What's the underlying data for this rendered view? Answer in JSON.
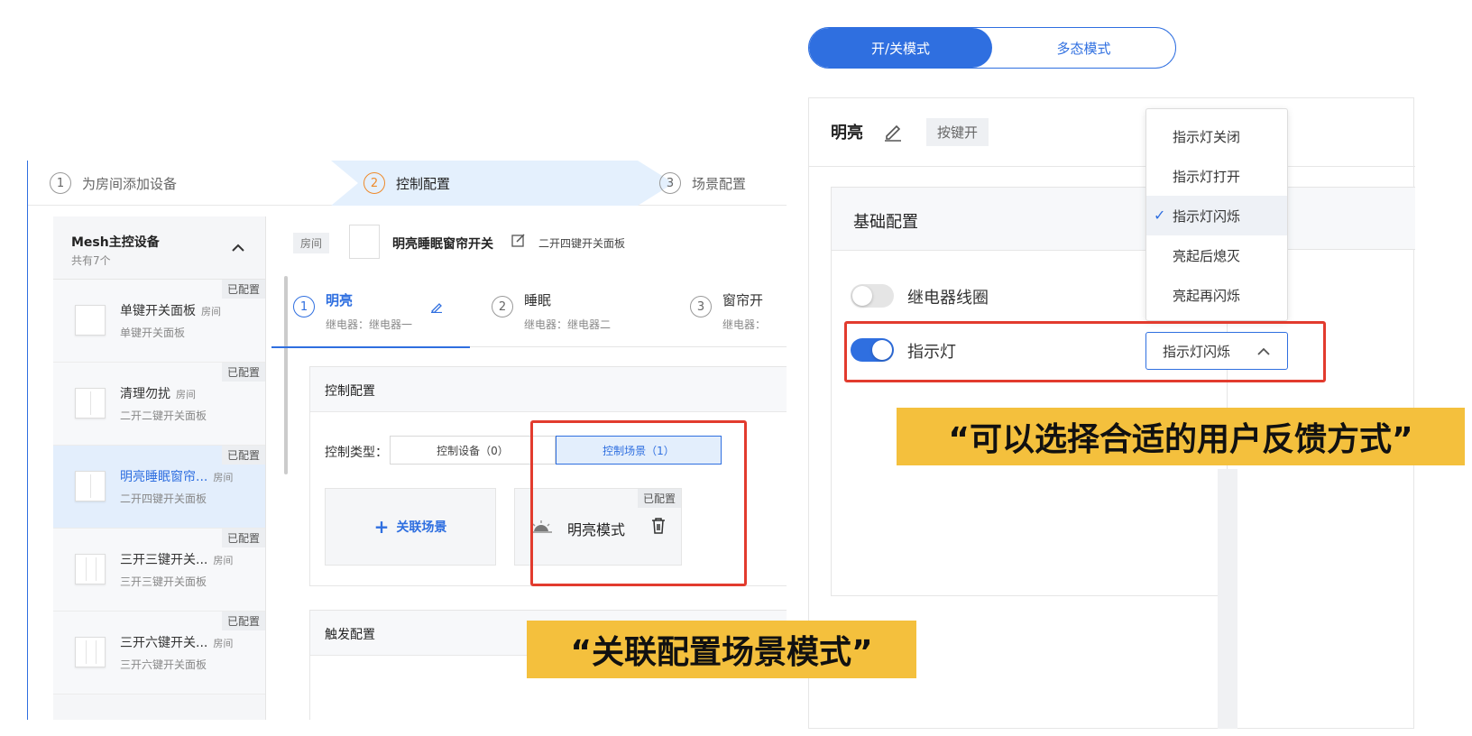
{
  "stepper": {
    "steps": [
      {
        "num": "1",
        "label": "为房间添加设备"
      },
      {
        "num": "2",
        "label": "控制配置"
      },
      {
        "num": "3",
        "label": "场景配置"
      }
    ]
  },
  "sidebar": {
    "title": "Mesh主控设备",
    "subtitle": "共有7个",
    "items": [
      {
        "name": "单键开关面板",
        "room": "房间",
        "type": "单键开关面板",
        "badge": "已配置"
      },
      {
        "name": "清理勿扰",
        "room": "房间",
        "type": "二开二键开关面板",
        "badge": "已配置"
      },
      {
        "name": "明亮睡眠窗帘...",
        "room": "房间",
        "type": "二开四键开关面板",
        "badge": "已配置"
      },
      {
        "name": "三开三键开关...",
        "room": "房间",
        "type": "三开三键开关面板",
        "badge": "已配置"
      },
      {
        "name": "三开六键开关...",
        "room": "房间",
        "type": "三开六键开关面板",
        "badge": "已配置"
      }
    ]
  },
  "device": {
    "room_tag": "房间",
    "name": "明亮睡眠窗帘开关",
    "type": "二开四键开关面板"
  },
  "buttons": [
    {
      "num": "1",
      "label": "明亮",
      "sub": "继电器：继电器一"
    },
    {
      "num": "2",
      "label": "睡眠",
      "sub": "继电器：继电器二"
    },
    {
      "num": "3",
      "label": "窗帘开",
      "sub": "继电器："
    }
  ],
  "control_card": {
    "title": "控制配置",
    "type_label": "控制类型：",
    "options": [
      "控制设备（0）",
      "控制场景（1）"
    ],
    "add_scene": "关联场景",
    "scene_badge": "已配置",
    "scene_name": "明亮模式"
  },
  "trigger_card": {
    "title": "触发配置"
  },
  "captions": {
    "scene": "“关联配置场景模式”",
    "feedback": "“可以选择合适的用户反馈方式”"
  },
  "right": {
    "modes": [
      "开/关模式",
      "多态模式"
    ],
    "title": "明亮",
    "tag": "按键开",
    "basic_title": "基础配置",
    "relay_label": "继电器线圈",
    "indicator_label": "指示灯",
    "select_value": "指示灯闪烁",
    "dropdown": [
      "指示灯关闭",
      "指示灯打开",
      "指示灯闪烁",
      "亮起后熄灭",
      "亮起再闪烁"
    ]
  },
  "colors": {
    "accent": "#2f6fe0",
    "highlight": "#e23b2e",
    "caption_bg": "#f4c03d"
  }
}
